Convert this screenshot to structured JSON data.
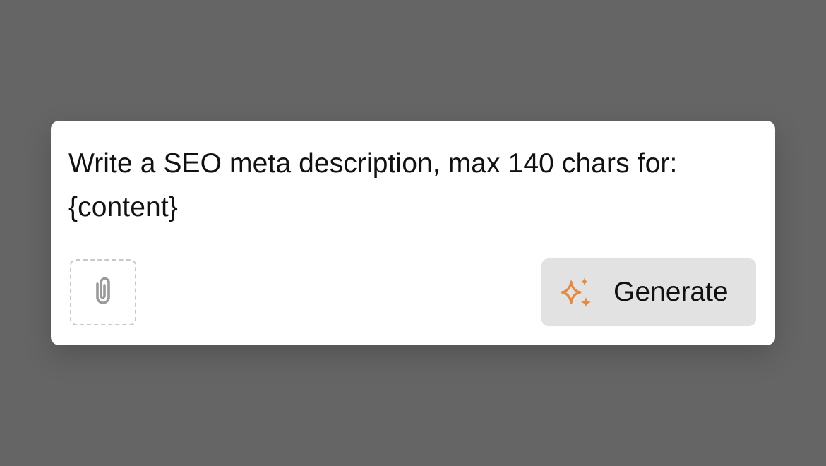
{
  "prompt": {
    "text": "Write a SEO meta description, max 140 chars for:\n{content}"
  },
  "attachment": {
    "icon": "paperclip-icon"
  },
  "generate": {
    "label": "Generate",
    "icon": "sparkle-icon",
    "icon_color": "#E8883A"
  },
  "colors": {
    "backdrop": "#656565",
    "card": "#FFFFFF",
    "button_bg": "#E2E2E2"
  }
}
